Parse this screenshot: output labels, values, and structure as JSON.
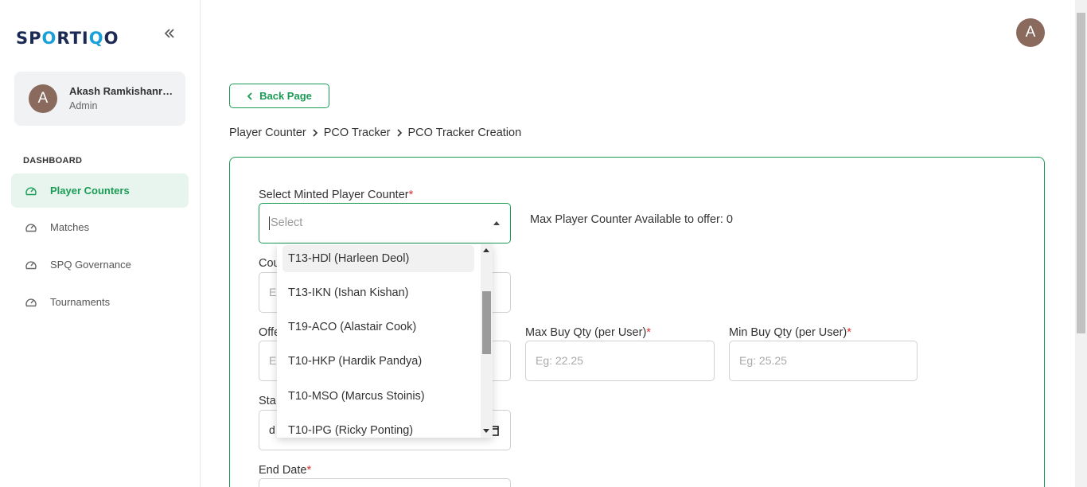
{
  "app": {
    "logo_text_a": "SP",
    "logo_text_o": "O",
    "logo_text_b": "RTI",
    "logo_text_q": "Q",
    "logo_text_c": "O"
  },
  "user": {
    "initial": "A",
    "name": "Akash Ramkishanra...",
    "role": "Admin"
  },
  "sidebar": {
    "section": "DASHBOARD",
    "items": [
      {
        "label": "Player Counters",
        "active": true
      },
      {
        "label": "Matches"
      },
      {
        "label": "SPQ Governance"
      },
      {
        "label": "Tournaments"
      }
    ]
  },
  "header": {
    "avatar_initial": "A"
  },
  "back_button": {
    "label": "Back Page"
  },
  "breadcrumb": [
    "Player Counter",
    "PCO Tracker",
    "PCO Tracker Creation"
  ],
  "form": {
    "select_label": "Select Minted Player Counter",
    "select_placeholder": "Select",
    "max_available": "Max Player Counter Available to offer: 0",
    "count_label_partial": "Cou",
    "count_placeholder_partial": "E",
    "offer_label_partial": "Offe",
    "offer_placeholder_partial": "E",
    "max_buy_label": "Max Buy Qty (per User)",
    "max_buy_placeholder": "Eg: 22.25",
    "min_buy_label": "Min Buy Qty (per User)",
    "min_buy_placeholder": "Eg: 25.25",
    "start_label_partial": "Sta",
    "start_value_partial": "d",
    "end_label": "End Date",
    "required_mark": "*"
  },
  "dropdown": {
    "options": [
      "T13-HDl (Harleen Deol)",
      "T13-IKN (Ishan Kishan)",
      "T19-ACO (Alastair Cook)",
      "T10-HKP (Hardik Pandya)",
      "T10-MSO (Marcus Stoinis)",
      "T10-IPG (Ricky Ponting)"
    ]
  },
  "colors": {
    "accent": "#1a9c55",
    "avatar": "#8a6a5c",
    "required": "#e03030"
  }
}
